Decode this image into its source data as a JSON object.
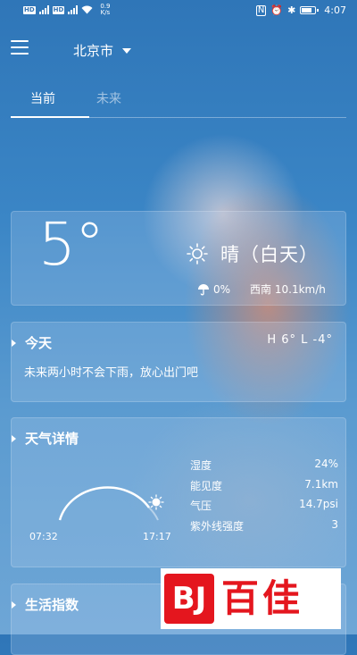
{
  "status_bar": {
    "network_badge": "HD",
    "signal_label": "4G",
    "speed_value": "0.9",
    "speed_unit": "K/s",
    "time": "4:07"
  },
  "header": {
    "city": "北京市"
  },
  "tabs": [
    {
      "label": "当前",
      "active": true
    },
    {
      "label": "未来",
      "active": false
    }
  ],
  "current": {
    "temperature": "5°",
    "condition": "晴（白天）",
    "precipitation": "0%",
    "wind": "西南 10.1km/h"
  },
  "today": {
    "title": "今天",
    "high_low": "H 6°   L -4°",
    "description": "未来两小时不会下雨，放心出门吧"
  },
  "detail": {
    "title": "天气详情",
    "sunrise": "07:32",
    "sunset": "17:17",
    "sun_progress": 0.92,
    "metrics": [
      {
        "label": "湿度",
        "value": "24%"
      },
      {
        "label": "能见度",
        "value": "7.1km"
      },
      {
        "label": "气压",
        "value": "14.7psi"
      },
      {
        "label": "紫外线强度",
        "value": "3"
      }
    ]
  },
  "life": {
    "title": "生活指数"
  },
  "watermark": {
    "mark": "BJ",
    "text": "百佳",
    "color": "#e4161e"
  }
}
